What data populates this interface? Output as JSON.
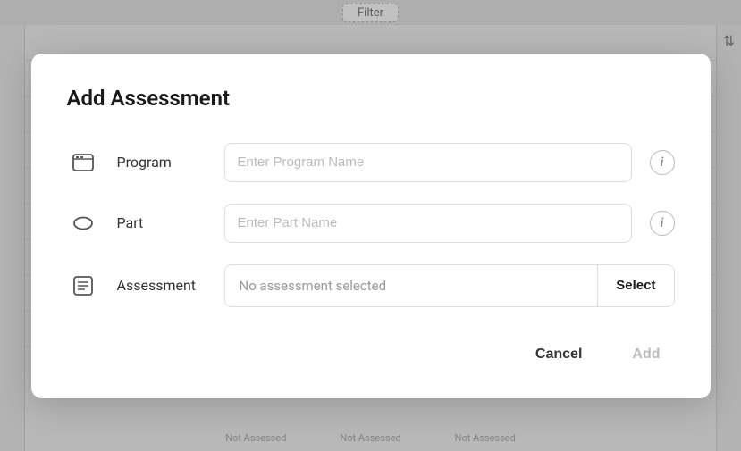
{
  "background": {
    "filter_label": "Filter",
    "not_assessed": [
      "Not Assessed",
      "Not Assessed",
      "Not Assessed"
    ]
  },
  "modal": {
    "title": "Add Assessment",
    "form": {
      "program_label": "Program",
      "program_placeholder": "Enter Program Name",
      "part_label": "Part",
      "part_placeholder": "Enter Part Name",
      "assessment_label": "Assessment",
      "assessment_placeholder": "No assessment selected",
      "select_button": "Select"
    },
    "footer": {
      "cancel_label": "Cancel",
      "add_label": "Add"
    }
  }
}
